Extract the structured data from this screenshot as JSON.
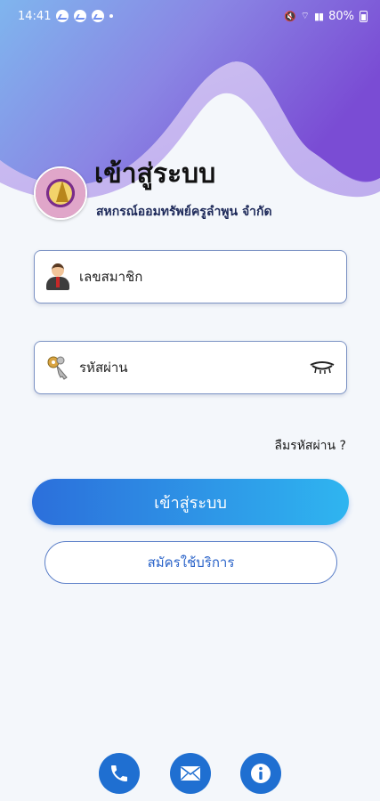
{
  "status_bar": {
    "time": "14:41",
    "battery": "80%"
  },
  "header": {
    "title": "เข้าสู่ระบบ",
    "subtitle": "สหกรณ์ออมทรัพย์ครูลำพูน จำกัด"
  },
  "form": {
    "member_placeholder": "เลขสมาชิก",
    "password_placeholder": "รหัสผ่าน",
    "forgot_label": "ลืมรหัสผ่าน ?",
    "login_label": "เข้าสู่ระบบ",
    "register_label": "สมัครใช้บริการ"
  },
  "icons": {
    "user": "user-icon",
    "key": "key-icon",
    "eye": "eye-closed-icon",
    "phone": "phone-icon",
    "mail": "mail-icon",
    "info": "info-icon"
  },
  "colors": {
    "accent": "#1f6fd1",
    "gradient_start": "#2c6fdb",
    "gradient_end": "#2fb5f0",
    "header_purple": "#7b4fd6"
  }
}
